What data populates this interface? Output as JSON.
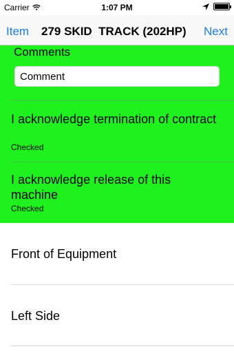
{
  "status_bar": {
    "carrier": "Carrier",
    "time": "1:07 PM",
    "icons": [
      "wifi-icon",
      "location-icon",
      "battery-icon"
    ]
  },
  "nav": {
    "left_label": "Item",
    "title": "279 SKID  TRACK (202HP)",
    "right_label": "Next"
  },
  "comments": {
    "label": "Comments",
    "value": "",
    "placeholder": "Comment"
  },
  "acknowledgements": [
    {
      "text": "I acknowledge termination of contract",
      "status": "Checked"
    },
    {
      "text": "I acknowledge release of this machine",
      "status": "Checked"
    }
  ],
  "sections": [
    {
      "label": "Front of Equipment"
    },
    {
      "label": "Left Side"
    }
  ],
  "colors": {
    "accent": "#1a7cf5",
    "highlight": "#1ef11e"
  }
}
